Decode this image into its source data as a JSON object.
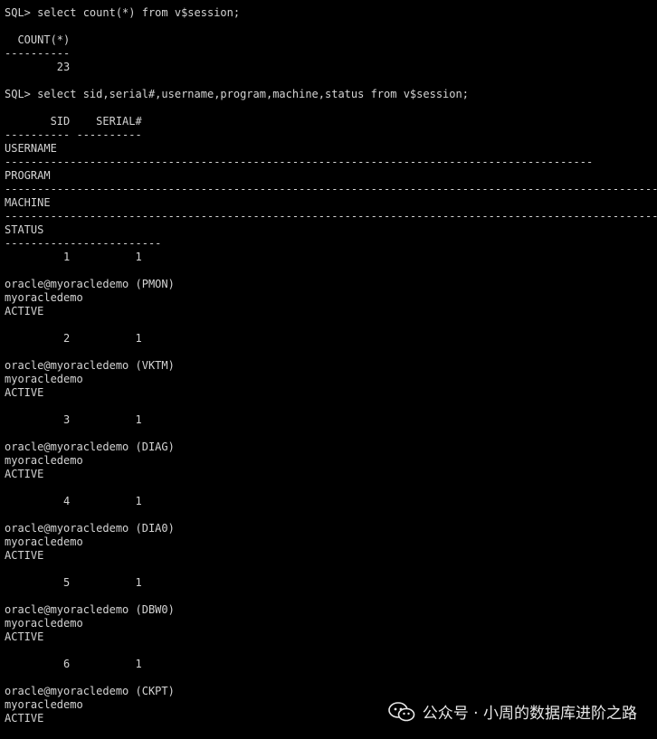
{
  "terminal": {
    "lines": [
      "SQL> select count(*) from v$session;",
      "",
      "  COUNT(*)",
      "----------",
      "        23",
      "",
      "SQL> select sid,serial#,username,program,machine,status from v$session;",
      "",
      "       SID    SERIAL#",
      "---------- ----------",
      "USERNAME",
      "------------------------------------------------------------------------------------------",
      "PROGRAM",
      "----------------------------------------------------------------------------------------------------",
      "MACHINE",
      "----------------------------------------------------------------------------------------------------",
      "STATUS",
      "------------------------",
      "         1          1",
      "",
      "oracle@myoracledemo (PMON)",
      "myoracledemo",
      "ACTIVE",
      "",
      "         2          1",
      "",
      "oracle@myoracledemo (VKTM)",
      "myoracledemo",
      "ACTIVE",
      "",
      "         3          1",
      "",
      "oracle@myoracledemo (DIAG)",
      "myoracledemo",
      "ACTIVE",
      "",
      "         4          1",
      "",
      "oracle@myoracledemo (DIA0)",
      "myoracledemo",
      "ACTIVE",
      "",
      "         5          1",
      "",
      "oracle@myoracledemo (DBW0)",
      "myoracledemo",
      "ACTIVE",
      "",
      "         6          1",
      "",
      "oracle@myoracledemo (CKPT)",
      "myoracledemo",
      "ACTIVE"
    ]
  },
  "watermark": {
    "text": "公众号 · 小周的数据库进阶之路",
    "icon": "wechat-icon"
  },
  "colors": {
    "background": "#000000",
    "text": "#d4d4d4"
  }
}
